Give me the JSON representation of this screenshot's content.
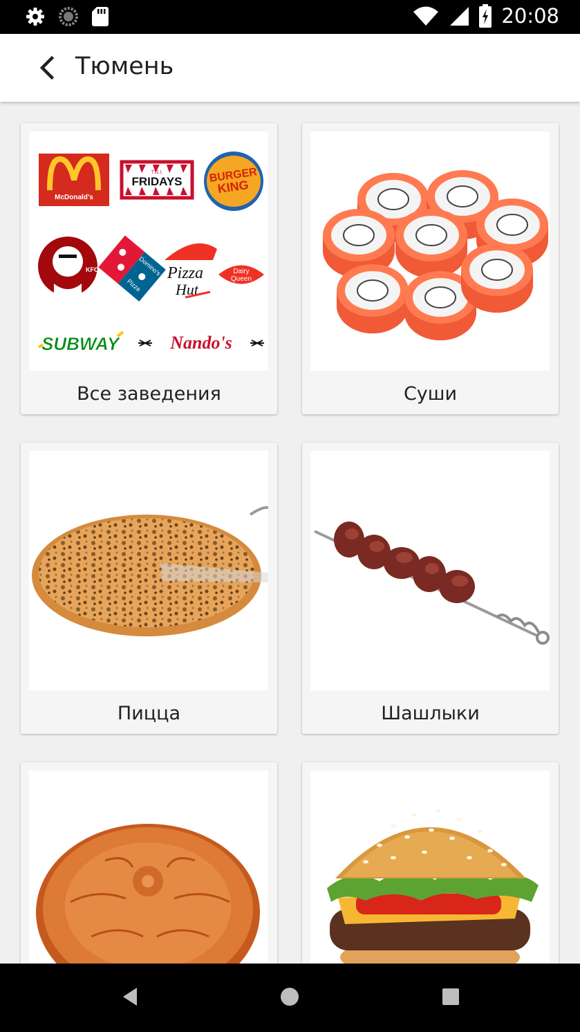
{
  "status_bar": {
    "time": "20:08",
    "left_icons": [
      "settings-icon",
      "sync-icon",
      "sd-card-icon"
    ],
    "right_icons": [
      "wifi-icon",
      "signal-icon",
      "battery-charging-icon"
    ]
  },
  "app_bar": {
    "title": "Тюмень",
    "back_icon": "arrow-back-icon"
  },
  "categories": [
    {
      "label": "Все заведения",
      "logos": {
        "mcdonalds": "McDonald's",
        "fridays_small": "T.G.I.",
        "fridays": "FRIDAYS",
        "bk_1": "BURGER",
        "bk_2": "KING",
        "kfc": "KFC",
        "dominos_1": "Domino's",
        "dominos_2": "Pizza",
        "pizzahut_1": "Pizza",
        "pizzahut_2": "Hut",
        "dq_1": "Dairy",
        "dq_2": "Queen",
        "subway": "SUBWAY",
        "nandos": "Nando's"
      }
    },
    {
      "label": "Суши"
    },
    {
      "label": "Пицца"
    },
    {
      "label": "Шашлыки"
    },
    {
      "label": ""
    },
    {
      "label": ""
    }
  ],
  "nav_bar": {
    "icons": [
      "back-triangle-icon",
      "home-circle-icon",
      "recents-square-icon"
    ]
  }
}
